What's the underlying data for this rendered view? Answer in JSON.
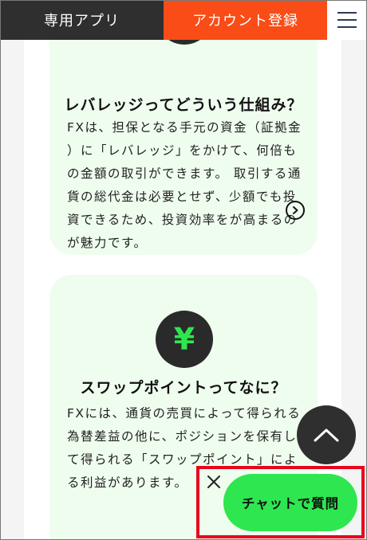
{
  "header": {
    "app_label": "専用アプリ",
    "register_label": "アカウント登録",
    "menu_icon": "hamburger-icon"
  },
  "cards": [
    {
      "icon": "yen-exchange-icon",
      "title": "レバレッジってどういう仕組み？",
      "lines": [
        "FXは、担保となる手元の資金（証拠金",
        "）に「レバレッジ」をかけて、何倍も",
        "の金額の取引ができます。 取引する通",
        "貨の総代金は必要とせず、少額でも投",
        "資できるため、投資効率をが高まるの",
        "が魅力です。"
      ],
      "link_icon": "chevron-right-circle-icon"
    },
    {
      "icon": "yen-icon",
      "icon_glyph": "¥",
      "title": "スワップポイントってなに？",
      "lines": [
        "FXには、通貨の売買によって得られる",
        "為替差益の他に、ポジションを保有し",
        "て得られる「スワップポイント」によ",
        "る利益があります。"
      ]
    }
  ],
  "scroll_top": {
    "icon": "chevron-up-icon"
  },
  "chat": {
    "close_icon": "close-icon",
    "button_label": "チャットで質問"
  },
  "colors": {
    "accent_green": "#2ee64f",
    "register_orange": "#fa4c17",
    "header_dark": "#2f2f2f",
    "card_bg": "#effdee",
    "highlight_red": "#e8061d"
  }
}
